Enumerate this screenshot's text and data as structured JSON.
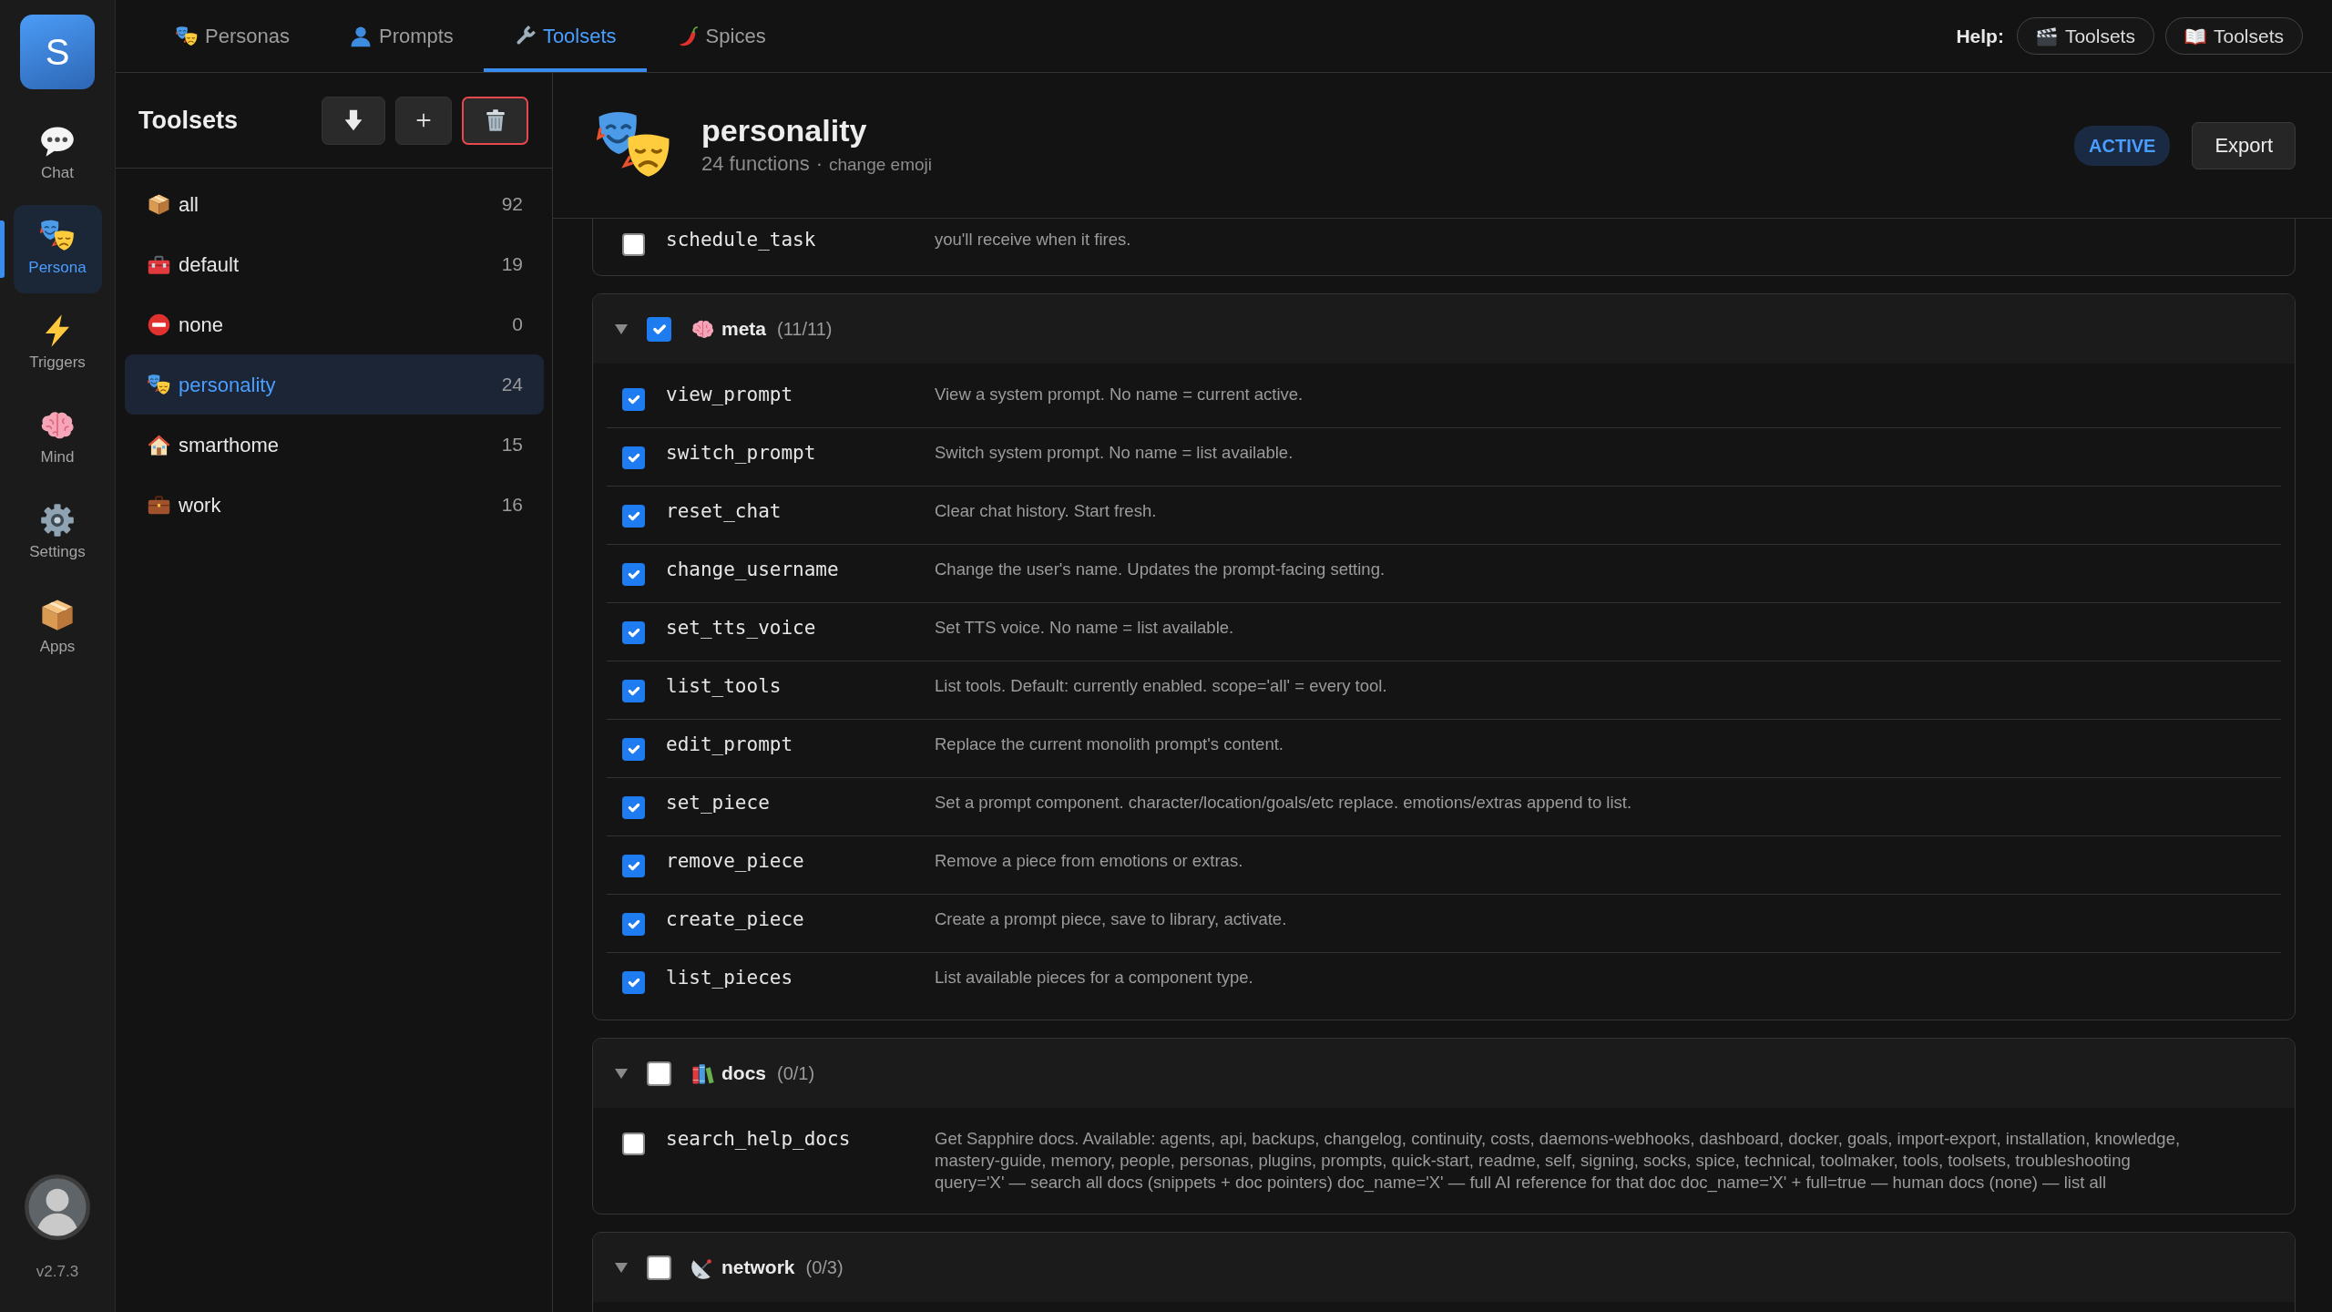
{
  "rail": {
    "logo": "S",
    "items": [
      {
        "label": "Chat",
        "selected": false
      },
      {
        "label": "Persona",
        "selected": true
      },
      {
        "label": "Triggers",
        "selected": false
      },
      {
        "label": "Mind",
        "selected": false
      },
      {
        "label": "Settings",
        "selected": false
      },
      {
        "label": "Apps",
        "selected": false
      }
    ],
    "version": "v2.7.3"
  },
  "tabs": [
    {
      "label": "Personas",
      "selected": false
    },
    {
      "label": "Prompts",
      "selected": false
    },
    {
      "label": "Toolsets",
      "selected": true
    },
    {
      "label": "Spices",
      "selected": false
    }
  ],
  "help": {
    "label": "Help:",
    "buttons": [
      "Toolsets",
      "Toolsets"
    ]
  },
  "sidebar": {
    "title": "Toolsets",
    "items": [
      {
        "label": "all",
        "count": "92",
        "selected": false
      },
      {
        "label": "default",
        "count": "19",
        "selected": false
      },
      {
        "label": "none",
        "count": "0",
        "selected": false
      },
      {
        "label": "personality",
        "count": "24",
        "selected": true
      },
      {
        "label": "smarthome",
        "count": "15",
        "selected": false
      },
      {
        "label": "work",
        "count": "16",
        "selected": false
      }
    ]
  },
  "toolset": {
    "title": "personality",
    "function_count": "24 functions",
    "separator": "·",
    "change_emoji": "change emoji",
    "status": "ACTIVE",
    "export": "Export"
  },
  "partial_group": {
    "rows": [
      {
        "name": "schedule_task",
        "description": "you'll receive when it fires.",
        "checked": false
      }
    ]
  },
  "groups": [
    {
      "label": "meta",
      "count": "(11/11)",
      "checked": true,
      "expanded": true,
      "rows": [
        {
          "name": "view_prompt",
          "description": "View a system prompt. No name = current active.",
          "checked": true
        },
        {
          "name": "switch_prompt",
          "description": "Switch system prompt. No name = list available.",
          "checked": true
        },
        {
          "name": "reset_chat",
          "description": "Clear chat history. Start fresh.",
          "checked": true
        },
        {
          "name": "change_username",
          "description": "Change the user's name. Updates the prompt-facing setting.",
          "checked": true
        },
        {
          "name": "set_tts_voice",
          "description": "Set TTS voice. No name = list available.",
          "checked": true
        },
        {
          "name": "list_tools",
          "description": "List tools. Default: currently enabled. scope='all' = every tool.",
          "checked": true
        },
        {
          "name": "edit_prompt",
          "description": "Replace the current monolith prompt's content.",
          "checked": true
        },
        {
          "name": "set_piece",
          "description": "Set a prompt component. character/location/goals/etc replace. emotions/extras append to list.",
          "checked": true
        },
        {
          "name": "remove_piece",
          "description": "Remove a piece from emotions or extras.",
          "checked": true
        },
        {
          "name": "create_piece",
          "description": "Create a prompt piece, save to library, activate.",
          "checked": true
        },
        {
          "name": "list_pieces",
          "description": "List available pieces for a component type.",
          "checked": true
        }
      ]
    },
    {
      "label": "docs",
      "count": "(0/1)",
      "checked": false,
      "expanded": true,
      "rows": [
        {
          "name": "search_help_docs",
          "description": "Get Sapphire docs. Available: agents, api, backups, changelog, continuity, costs, daemons-webhooks, dashboard, docker, goals, import-export, installation, knowledge, mastery-guide, memory, people, personas, plugins, prompts, quick-start, readme, self, signing, socks, spice, technical, toolmaker, tools, toolsets, troubleshooting\nquery='X' — search all docs (snippets + doc pointers) doc_name='X' — full AI reference for that doc doc_name='X' + full=true — human docs (none) — list all",
          "checked": false
        }
      ]
    },
    {
      "label": "network",
      "count": "(0/3)",
      "checked": false,
      "expanded": true
    }
  ]
}
